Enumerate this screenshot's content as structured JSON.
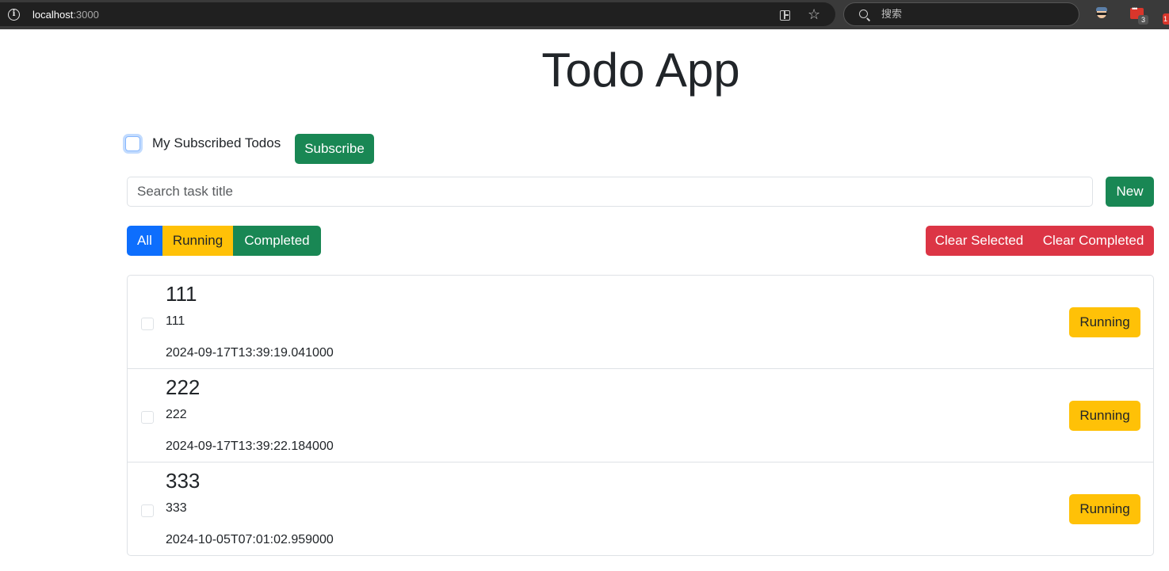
{
  "browser": {
    "url_host": "localhost",
    "url_port": ":3000",
    "search_placeholder": "搜索",
    "mail_badge": "3",
    "edge_badge": "1"
  },
  "app": {
    "title": "Todo App",
    "subscribe_label": "My Subscribed Todos",
    "subscribe_button": "Subscribe",
    "subscribed_checked": false,
    "search_placeholder": "Search task title",
    "search_value": "",
    "new_button": "New",
    "filters": {
      "all": "All",
      "running": "Running",
      "completed": "Completed"
    },
    "clear_selected": "Clear Selected",
    "clear_completed": "Clear Completed"
  },
  "todos": [
    {
      "title": "111",
      "description": "111",
      "date": "2024-09-17T13:39:19.041000",
      "status": "Running",
      "checked": false
    },
    {
      "title": "222",
      "description": "222",
      "date": "2024-09-17T13:39:22.184000",
      "status": "Running",
      "checked": false
    },
    {
      "title": "333",
      "description": "333",
      "date": "2024-10-05T07:01:02.959000",
      "status": "Running",
      "checked": false
    }
  ],
  "colors": {
    "primary": "#0d6efd",
    "success": "#198754",
    "warning": "#ffc107",
    "danger": "#dc3545",
    "browser_bar": "#3a3a3a"
  }
}
